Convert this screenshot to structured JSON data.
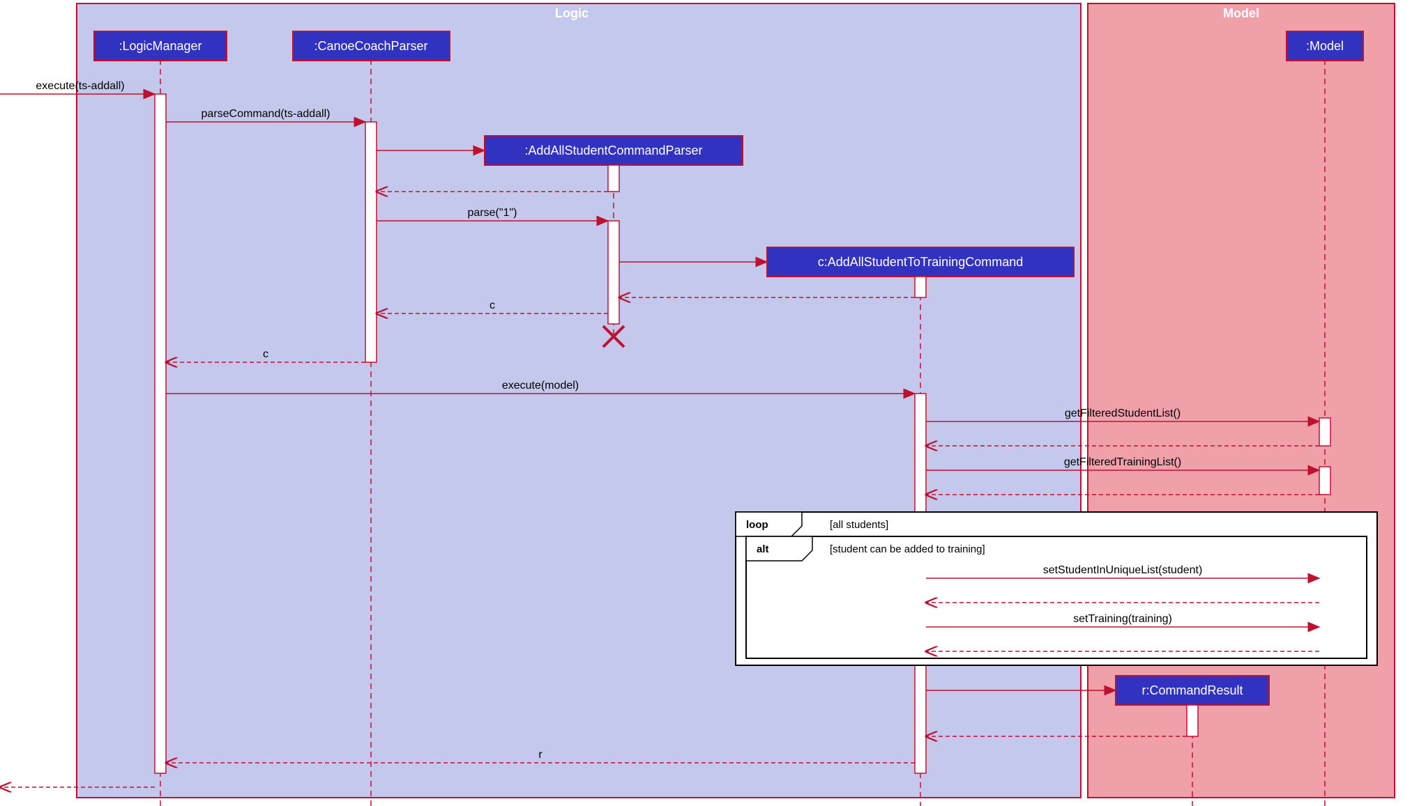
{
  "regions": {
    "logic": {
      "label": "Logic"
    },
    "model": {
      "label": "Model"
    }
  },
  "participants": {
    "logicManager": ":LogicManager",
    "canoeCoachParser": ":CanoeCoachParser",
    "addAllStudentCommandParser": ":AddAllStudentCommandParser",
    "addAllStudentToTrainingCommand": "c:AddAllStudentToTrainingCommand",
    "model": ":Model",
    "commandResult": "r:CommandResult"
  },
  "messages": {
    "m1": "execute(ts-addall)",
    "m2": "parseCommand(ts-addall)",
    "m3": "parse(\"1\")",
    "m4": "c",
    "m5": "c",
    "m6": "execute(model)",
    "m7": "getFilteredStudentList()",
    "m8": "getFilteredTrainingList()",
    "m9": "setStudentInUniqueList(student)",
    "m10": "setTraining(training)",
    "m11": "r"
  },
  "frames": {
    "loop": {
      "label": "loop",
      "guard": "[all students]"
    },
    "alt": {
      "label": "alt",
      "guard": "[student can be added to training]"
    }
  }
}
